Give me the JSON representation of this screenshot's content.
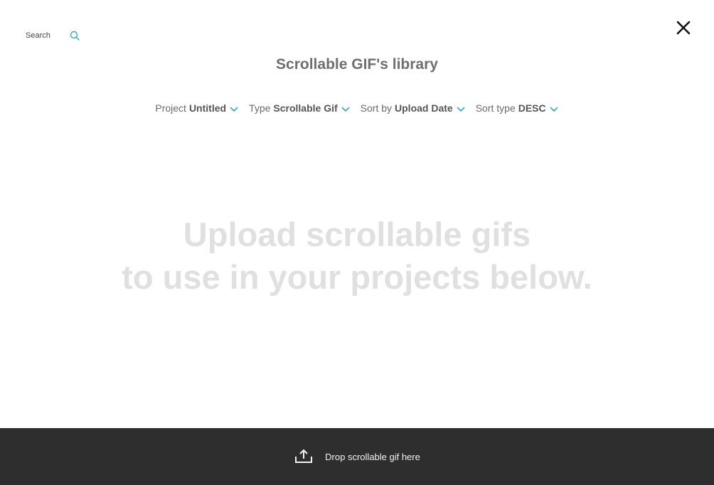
{
  "search": {
    "placeholder": "Search",
    "icon": "search-icon"
  },
  "close": {
    "icon": "close-icon"
  },
  "library": {
    "title": "Scrollable GIF's library"
  },
  "filters": [
    {
      "label": "Project",
      "value": "Untitled"
    },
    {
      "label": "Type",
      "value": "Scrollable Gif"
    },
    {
      "label": "Sort by",
      "value": "Upload Date"
    },
    {
      "label": "Sort type",
      "value": "DESC"
    }
  ],
  "empty_state": {
    "line1": "Upload scrollable gifs",
    "line2": "to use in your projects below."
  },
  "dropzone": {
    "label": "Drop scrollable gif here",
    "icon": "upload-icon"
  },
  "colors": {
    "accent": "#2fa9c6",
    "dropzone_bg": "#2e2e2e",
    "empty_text": "#e0e0e0"
  }
}
